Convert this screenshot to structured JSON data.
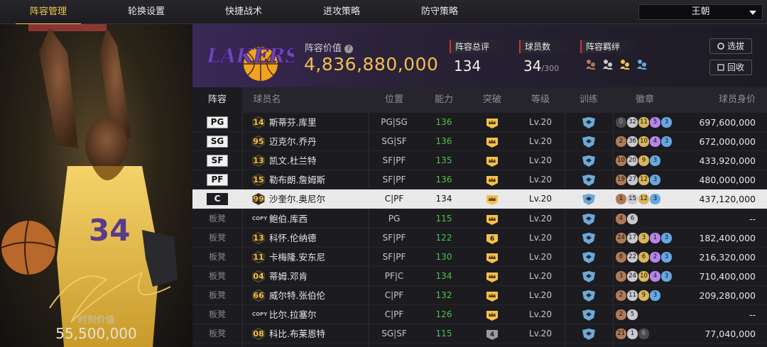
{
  "nav": {
    "tabs": [
      "阵容管理",
      "轮换设置",
      "快捷战术",
      "进攻策略",
      "防守策略"
    ],
    "active_index": 0,
    "selected_player": "王朝"
  },
  "portrait": {
    "player_jersey": "34",
    "moment_label": "时刻价值",
    "moment_value": "55,500,000"
  },
  "header": {
    "team_logo_text": "LAKERS",
    "lineup_value_label": "阵容价值",
    "lineup_value": "4,836,880,000",
    "rating_label": "阵容总评",
    "rating_value": "134",
    "count_label": "球员数",
    "count_value": "34",
    "count_max": "/300",
    "bond_label": "阵容羁绊",
    "select_button": "选拔",
    "recycle_button": "回收"
  },
  "table": {
    "headers": [
      "阵容",
      "球员名",
      "位置",
      "能力",
      "突破",
      "等级",
      "训练",
      "徽章",
      "球员身价"
    ],
    "rows": [
      {
        "slot": "PG",
        "starter": true,
        "number": "14",
        "name": "斯蒂芬.库里",
        "position": "PG|SG",
        "ability": "136",
        "break": "crown",
        "level": "Lv.20",
        "badges": [
          [
            0,
            "0"
          ],
          [
            2,
            "32"
          ],
          [
            3,
            "11"
          ],
          [
            4,
            "5"
          ],
          [
            5,
            "3"
          ]
        ],
        "price": "697,600,000"
      },
      {
        "slot": "SG",
        "starter": true,
        "number": "95",
        "name": "迈克尔.乔丹",
        "position": "SG|SF",
        "ability": "136",
        "break": "crown",
        "level": "Lv.20",
        "badges": [
          [
            1,
            "2"
          ],
          [
            2,
            "36"
          ],
          [
            3,
            "10"
          ],
          [
            4,
            "4"
          ],
          [
            5,
            "3"
          ]
        ],
        "price": "672,000,000"
      },
      {
        "slot": "SF",
        "starter": true,
        "number": "13",
        "name": "凯文.杜兰特",
        "position": "SF|PF",
        "ability": "135",
        "break": "crown",
        "level": "Lv.20",
        "badges": [
          [
            1,
            "10"
          ],
          [
            2,
            "20"
          ],
          [
            3,
            "9"
          ],
          [
            5,
            "3"
          ]
        ],
        "price": "433,920,000"
      },
      {
        "slot": "PF",
        "starter": true,
        "number": "15",
        "name": "勒布朗.詹姆斯",
        "position": "SF|PF",
        "ability": "136",
        "break": "crown",
        "level": "Lv.20",
        "badges": [
          [
            1,
            "19"
          ],
          [
            2,
            "27"
          ],
          [
            3,
            "12"
          ],
          [
            5,
            "3"
          ]
        ],
        "price": "480,000,000"
      },
      {
        "slot": "C",
        "starter": true,
        "selected": true,
        "number": "99",
        "name": "沙奎尔.奥尼尔",
        "position": "C|PF",
        "ability": "134",
        "break": "crown",
        "level": "Lv.20",
        "badges": [
          [
            1,
            "1"
          ],
          [
            2,
            "15"
          ],
          [
            3,
            "12"
          ],
          [
            5,
            "3"
          ]
        ],
        "price": "437,120,000"
      },
      {
        "slot": "板凳",
        "starter": false,
        "number": "COPY",
        "name": "鲍伯.库西",
        "position": "PG",
        "ability": "115",
        "break": "crown",
        "level": "Lv.20",
        "badges": [
          [
            1,
            "4"
          ],
          [
            2,
            "6"
          ]
        ],
        "price": "--"
      },
      {
        "slot": "板凳",
        "starter": false,
        "number": "13",
        "name": "科怀.伦纳德",
        "position": "SF|PF",
        "ability": "122",
        "break": "6",
        "level": "Lv.20",
        "badges": [
          [
            1,
            "24"
          ],
          [
            2,
            "17"
          ],
          [
            3,
            "3"
          ],
          [
            4,
            "1"
          ],
          [
            5,
            "3"
          ]
        ],
        "price": "182,400,000"
      },
      {
        "slot": "板凳",
        "starter": false,
        "number": "11",
        "name": "卡梅隆.安东尼",
        "position": "SF|PF",
        "ability": "130",
        "break": "crown",
        "level": "Lv.20",
        "badges": [
          [
            1,
            "8"
          ],
          [
            2,
            "22"
          ],
          [
            3,
            "6"
          ],
          [
            4,
            "2"
          ],
          [
            5,
            "3"
          ]
        ],
        "price": "216,320,000"
      },
      {
        "slot": "板凳",
        "starter": false,
        "number": "04",
        "name": "蒂姆.邓肯",
        "position": "PF|C",
        "ability": "134",
        "break": "crown",
        "level": "Lv.20",
        "badges": [
          [
            1,
            "3"
          ],
          [
            2,
            "24"
          ],
          [
            3,
            "10"
          ],
          [
            4,
            "4"
          ],
          [
            5,
            "3"
          ]
        ],
        "price": "710,400,000"
      },
      {
        "slot": "板凳",
        "starter": false,
        "number": "66",
        "name": "威尔特.张伯伦",
        "position": "C|PF",
        "ability": "132",
        "break": "crown",
        "level": "Lv.20",
        "badges": [
          [
            1,
            "2"
          ],
          [
            2,
            "11"
          ],
          [
            3,
            "9"
          ],
          [
            5,
            "3"
          ]
        ],
        "price": "209,280,000"
      },
      {
        "slot": "板凳",
        "starter": false,
        "number": "COPY",
        "name": "比尔.拉塞尔",
        "position": "C|PF",
        "ability": "126",
        "break": "crown",
        "level": "Lv.20",
        "badges": [
          [
            1,
            "2"
          ],
          [
            2,
            "5"
          ]
        ],
        "price": "--"
      },
      {
        "slot": "板凳",
        "starter": false,
        "number": "08",
        "name": "科比.布莱恩特",
        "position": "SG|SF",
        "ability": "115",
        "break": "4",
        "level": "Lv.20",
        "badges": [
          [
            1,
            "21"
          ],
          [
            2,
            "1"
          ],
          [
            0,
            "6"
          ]
        ],
        "price": "77,040,000"
      }
    ]
  },
  "colors": {
    "accent_gold": "#f2bf4c",
    "ability_green": "#4fc24f",
    "header_purple": "#3a2858",
    "selected_row": "#e9e9ea"
  }
}
